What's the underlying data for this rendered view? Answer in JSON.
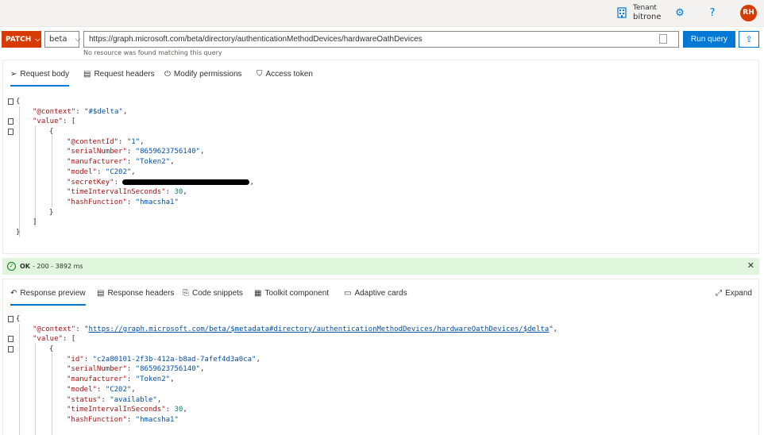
{
  "header": {
    "tenant_label": "Tenant",
    "tenant_name": "bitrone",
    "avatar_initials": "RH",
    "help_label": "?"
  },
  "query": {
    "method": "PATCH",
    "version": "beta",
    "url": "https://graph.microsoft.com/beta/directory/authenticationMethodDevices/hardwareOathDevices",
    "message": "No resource was found matching this query",
    "run_label": "Run query"
  },
  "request_tabs": [
    "Request body",
    "Request headers",
    "Modify permissions",
    "Access token"
  ],
  "request_body": {
    "open": "{",
    "context_key": "\"@context\"",
    "context_val": "\"#$delta\"",
    "value_key": "\"value\"",
    "item_open": "{",
    "content_id_key": "\"@contentId\"",
    "content_id_val": "\"1\"",
    "serial_key": "\"serialNumber\"",
    "serial_val": "\"8659623756140\"",
    "manufacturer_key": "\"manufacturer\"",
    "manufacturer_val": "\"Token2\"",
    "model_key": "\"model\"",
    "model_val": "\"C202\"",
    "secret_key": "\"secretKey\"",
    "interval_key": "\"timeIntervalInSeconds\"",
    "interval_val": "30",
    "hash_key": "\"hashFunction\"",
    "hash_val": "\"hmacsha1\""
  },
  "status": {
    "ok": "OK",
    "detail": "- 200 - 3892 ms"
  },
  "response_tabs": [
    "Response preview",
    "Response headers",
    "Code snippets",
    "Toolkit component",
    "Adaptive cards"
  ],
  "expand_label": "Expand",
  "response_body": {
    "context_key": "\"@context\"",
    "context_url": "https://graph.microsoft.com/beta/$metadata#directory/authenticationMethodDevices/hardwareOathDevices/$delta",
    "value_key": "\"value\"",
    "id_key": "\"id\"",
    "id_val": "\"c2a80101-2f3b-412a-b8ad-7afef4d3a0ca\"",
    "serial_key": "\"serialNumber\"",
    "serial_val": "\"8659623756140\"",
    "manufacturer_key": "\"manufacturer\"",
    "manufacturer_val": "\"Token2\"",
    "model_key": "\"model\"",
    "model_val": "\"C202\"",
    "status_key": "\"status\"",
    "status_val": "\"available\"",
    "interval_key": "\"timeIntervalInSeconds\"",
    "interval_val": "30",
    "hash_key": "\"hashFunction\"",
    "hash_val": "\"hmacsha1\""
  }
}
